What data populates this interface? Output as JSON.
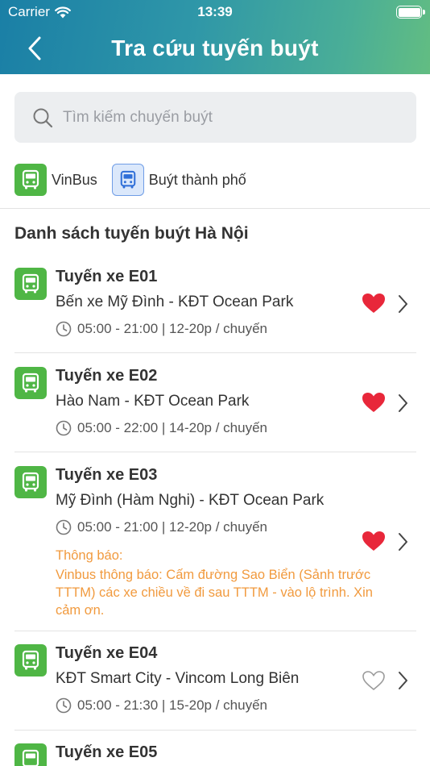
{
  "status_bar": {
    "carrier": "Carrier",
    "time": "13:39",
    "battery_level": 1.0
  },
  "header": {
    "title": "Tra cứu tuyến buýt",
    "back_icon": "chevron-left-icon"
  },
  "search": {
    "placeholder": "Tìm kiếm chuyến buýt",
    "value": ""
  },
  "filters": [
    {
      "label": "VinBus",
      "selected": false
    },
    {
      "label": "Buýt thành phố",
      "selected": true
    }
  ],
  "section_title": "Danh sách tuyến buýt Hà Nội",
  "colors": {
    "accent_green": "#4fb645",
    "heart_red": "#e8273a",
    "notice_orange": "#f19a3e"
  },
  "routes": [
    {
      "name": "Tuyến xe E01",
      "path": "Bến xe Mỹ Đình - KĐT Ocean Park",
      "schedule": "05:00 - 21:00 | 12-20p / chuyến",
      "favorite": true
    },
    {
      "name": "Tuyến xe E02",
      "path": "Hào Nam - KĐT Ocean Park",
      "schedule": "05:00 - 22:00 | 14-20p / chuyến",
      "favorite": true
    },
    {
      "name": "Tuyến xe E03",
      "path": "Mỹ Đình (Hàm Nghi) - KĐT Ocean Park",
      "schedule": "05:00 - 21:00 | 12-20p / chuyến",
      "favorite": true,
      "notice_title": "Thông báo:",
      "notice_body": "Vinbus thông báo: Cấm đường Sao Biển (Sảnh trước TTTM) các xe chiều về đi sau TTTM -  vào lộ trình. Xin cảm ơn."
    },
    {
      "name": "Tuyến xe E04",
      "path": "KĐT Smart City - Vincom Long Biên",
      "schedule": "05:00 - 21:30 | 15-20p / chuyến",
      "favorite": false
    },
    {
      "name": "Tuyến xe E05"
    }
  ]
}
